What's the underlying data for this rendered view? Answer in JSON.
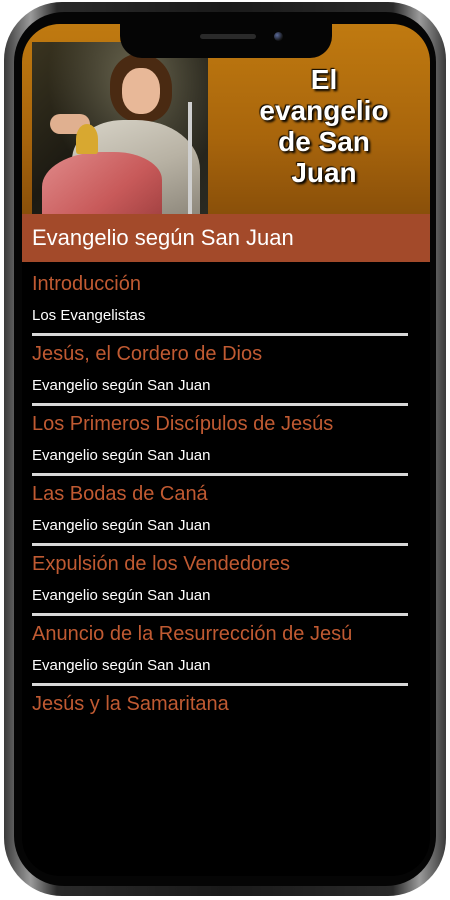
{
  "header": {
    "title": "El\nevangelio\nde San\nJuan"
  },
  "subtitle": "Evangelio según San Juan",
  "items": [
    {
      "title": "Introducción",
      "subtitle": "Los Evangelistas"
    },
    {
      "title": "Jesús, el Cordero de Dios",
      "subtitle": "Evangelio según San Juan"
    },
    {
      "title": "Los Primeros Discípulos de Jesús",
      "subtitle": "Evangelio según San Juan"
    },
    {
      "title": "Las Bodas de Caná",
      "subtitle": "Evangelio según San Juan"
    },
    {
      "title": "Expulsión de los Vendedores",
      "subtitle": "Evangelio según San Juan"
    },
    {
      "title": "Anuncio de la Resurrección de Jesú",
      "subtitle": "Evangelio según San Juan"
    },
    {
      "title": "Jesús y la Samaritana",
      "subtitle": ""
    }
  ],
  "colors": {
    "header_bg": "#b06e0e",
    "subbar_bg": "#a34a2a",
    "item_title": "#c05a32",
    "item_subtitle": "#ffffff",
    "screen_bg": "#000000"
  }
}
